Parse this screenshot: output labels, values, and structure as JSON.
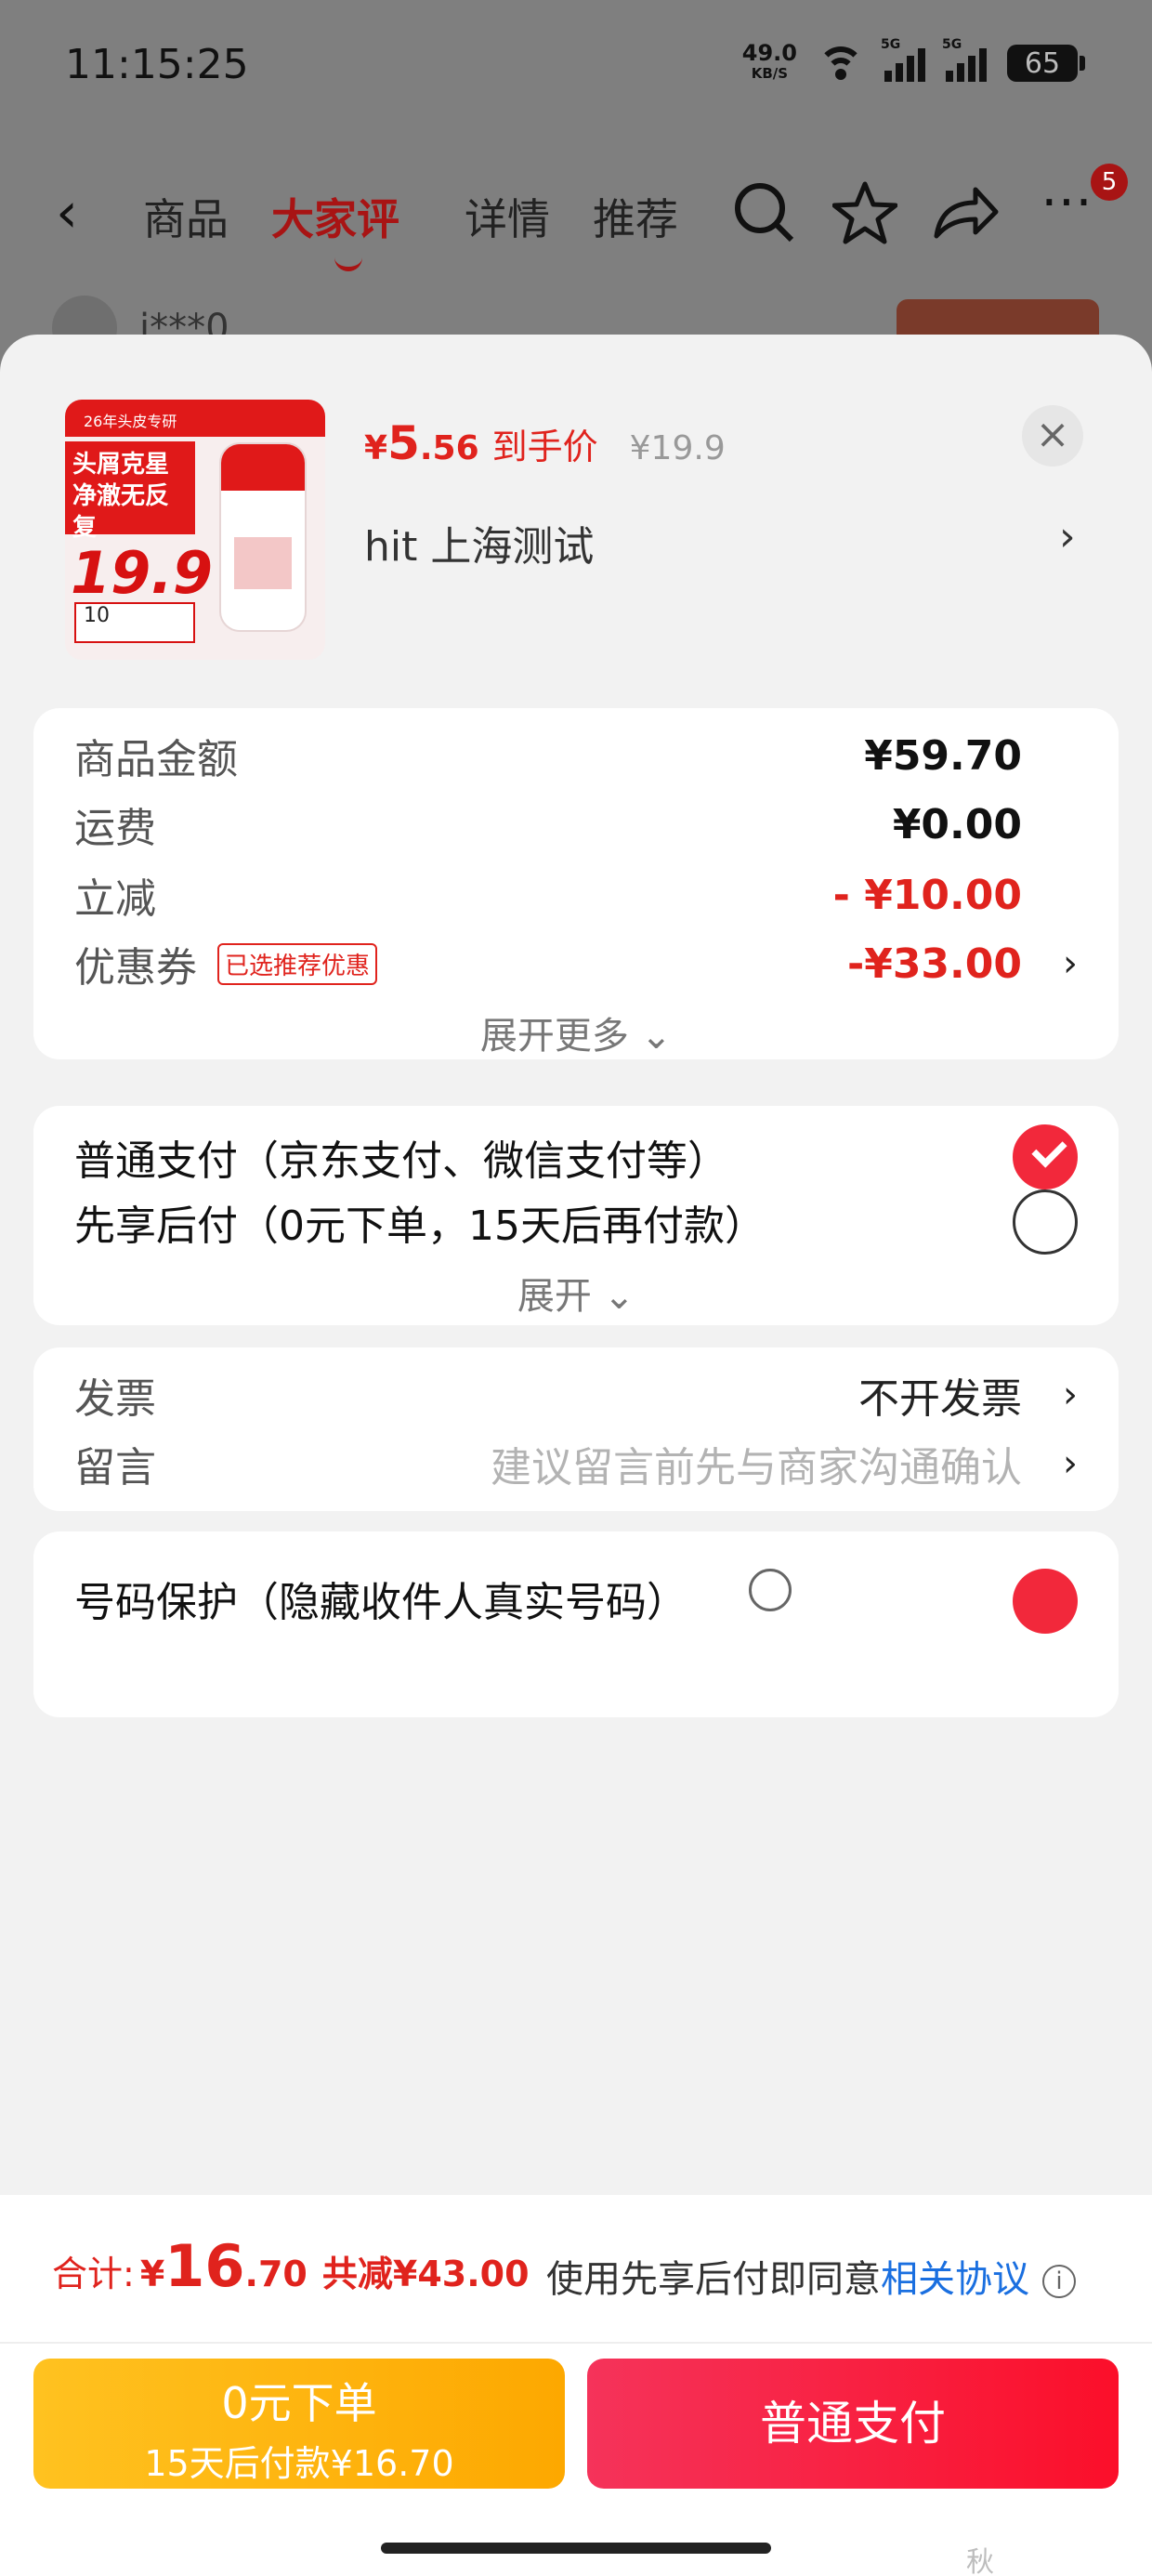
{
  "status": {
    "time": "11:15:25",
    "net_speed": "49.0",
    "net_unit": "KB/S",
    "signal_tag": "5G",
    "battery": "65"
  },
  "topnav": {
    "tabs": [
      "商品",
      "大家评",
      "详情",
      "推荐"
    ],
    "badge": "5",
    "review_user": "i***0"
  },
  "product": {
    "thumb": {
      "ribbon": "26年头皮专研",
      "headline": "头屑克星 净澈无反复",
      "price": "19.9",
      "chip": "10"
    },
    "currency": "¥",
    "final_int": "5",
    "final_dec": ".56",
    "final_label": "到手价",
    "original_price": "¥19.9",
    "address": "hit  上海测试",
    "close": "×"
  },
  "fees": {
    "rows": [
      {
        "label": "商品金额",
        "value": "¥59.70"
      },
      {
        "label": "运费",
        "value": "¥0.00"
      },
      {
        "label": "立减",
        "value": "- ¥10.00"
      },
      {
        "label": "优惠券",
        "value": "-¥33.00",
        "tag": "已选推荐优惠"
      }
    ],
    "more": "展开更多 ⌄"
  },
  "payment": {
    "options": [
      {
        "label": "普通支付（京东支付、微信支付等）",
        "selected": true
      },
      {
        "label": "先享后付（0元下单，15天后再付款）",
        "selected": false
      }
    ],
    "more": "展开 ⌄"
  },
  "extras": {
    "rows": [
      {
        "label": "发票",
        "value": "不开发票"
      },
      {
        "label": "留言",
        "value": "建议留言前先与商家沟通确认"
      }
    ]
  },
  "peek": {
    "label": "号码保护（隐藏收件人真实号码）"
  },
  "footer": {
    "total_label": "合计:",
    "total_currency": "¥",
    "total_int": "16",
    "total_dec": ".70",
    "total_saved": "共减¥43.00",
    "agree_text": "使用先享后付即同意",
    "agree_link": "相关协议",
    "btn_later_title": "0元下单",
    "btn_later_sub": "15天后付款¥16.70",
    "btn_pay": "普通支付",
    "watermark": "秋 zhizhizhi.com"
  },
  "colors": {
    "accent": "#e0231d",
    "pay_gradient_start": "#f5335a",
    "later_gradient_start": "#ffc220",
    "link": "#1a6fe0"
  }
}
